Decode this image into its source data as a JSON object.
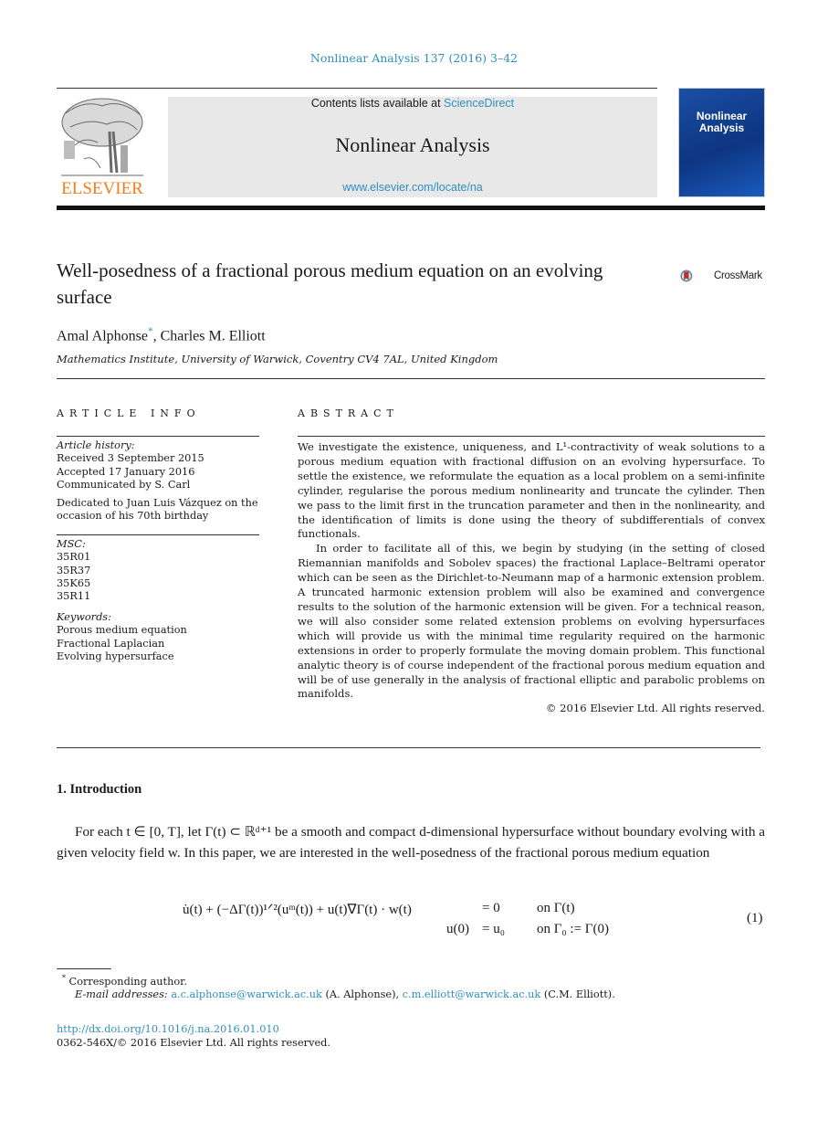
{
  "header": {
    "journal_ref": "Nonlinear Analysis 137 (2016) 3–42",
    "contents_prefix": "Contents lists available at ",
    "contents_link": "ScienceDirect",
    "journal_title": "Nonlinear Analysis",
    "journal_url": "www.elsevier.com/locate/na",
    "publisher_logo_text": "ELSEVIER",
    "cover_title_line1": "Nonlinear",
    "cover_title_line2": "Analysis",
    "publisher_color": "#f37d20",
    "link_color": "#2f8fbf"
  },
  "article": {
    "title": "Well-posedness of a fractional porous medium equation on an evolving surface",
    "crossmark_label": "CrossMark",
    "author1": "Amal Alphonse",
    "author1_mark": "*",
    "author_sep": ", ",
    "author2": "Charles M. Elliott",
    "affiliation": "Mathematics Institute, University of Warwick, Coventry CV4 7AL, United Kingdom"
  },
  "article_info": {
    "heading": "ARTICLE INFO",
    "history_label": "Article history:",
    "history": [
      "Received 3 September 2015",
      "Accepted 17 January 2016",
      "Communicated by S. Carl"
    ],
    "dedication": "Dedicated to Juan Luis Vázquez on the occasion of his 70th birthday",
    "msc_label": "MSC:",
    "msc": [
      "35R01",
      "35R37",
      "35K65",
      "35R11"
    ],
    "keywords_label": "Keywords:",
    "keywords": [
      "Porous medium equation",
      "Fractional Laplacian",
      "Evolving hypersurface"
    ]
  },
  "abstract": {
    "heading": "ABSTRACT",
    "p1": "We investigate the existence, uniqueness, and L¹-contractivity of weak solutions to a porous medium equation with fractional diffusion on an evolving hypersurface. To settle the existence, we reformulate the equation as a local problem on a semi-infinite cylinder, regularise the porous medium nonlinearity and truncate the cylinder. Then we pass to the limit first in the truncation parameter and then in the nonlinearity, and the identification of limits is done using the theory of subdifferentials of convex functionals.",
    "p2": "In order to facilitate all of this, we begin by studying (in the setting of closed Riemannian manifolds and Sobolev spaces) the fractional Laplace–Beltrami operator which can be seen as the Dirichlet-to-Neumann map of a harmonic extension problem. A truncated harmonic extension problem will also be examined and convergence results to the solution of the harmonic extension will be given. For a technical reason, we will also consider some related extension problems on evolving hypersurfaces which will provide us with the minimal time regularity required on the harmonic extensions in order to properly formulate the moving domain problem. This functional analytic theory is of course independent of the fractional porous medium equation and will be of use generally in the analysis of fractional elliptic and parabolic problems on manifolds.",
    "copyright": "© 2016 Elsevier Ltd. All rights reserved."
  },
  "intro": {
    "heading": "1.  Introduction",
    "paragraph": "For each t ∈ [0, T], let Γ(t) ⊂ ℝᵈ⁺¹ be a smooth and compact d-dimensional hypersurface without boundary evolving with a given velocity field w. In this paper, we are interested in the well-posedness of the fractional porous medium equation",
    "eq1_lhs": "u̇(t) + (−ΔΓ(t))¹ᐟ²(uᵐ(t)) + u(t)∇Γ(t) · w(t)",
    "eq1_rhs": "= 0",
    "eq1_cond": "on Γ(t)",
    "eq2_lhs": "u(0)",
    "eq2_rhs": "= u₀",
    "eq2_cond": "on Γ₀ := Γ(0)",
    "eq_number": "(1)"
  },
  "footnotes": {
    "mark": "*",
    "corresponding": "Corresponding author.",
    "email_label": "E-mail addresses:",
    "email1": "a.c.alphonse@warwick.ac.uk",
    "email1_owner": " (A. Alphonse), ",
    "email2": "c.m.elliott@warwick.ac.uk",
    "email2_owner": " (C.M. Elliott).",
    "doi": "http://dx.doi.org/10.1016/j.na.2016.01.010",
    "issn": "0362-546X/© 2016 Elsevier Ltd. All rights reserved."
  }
}
